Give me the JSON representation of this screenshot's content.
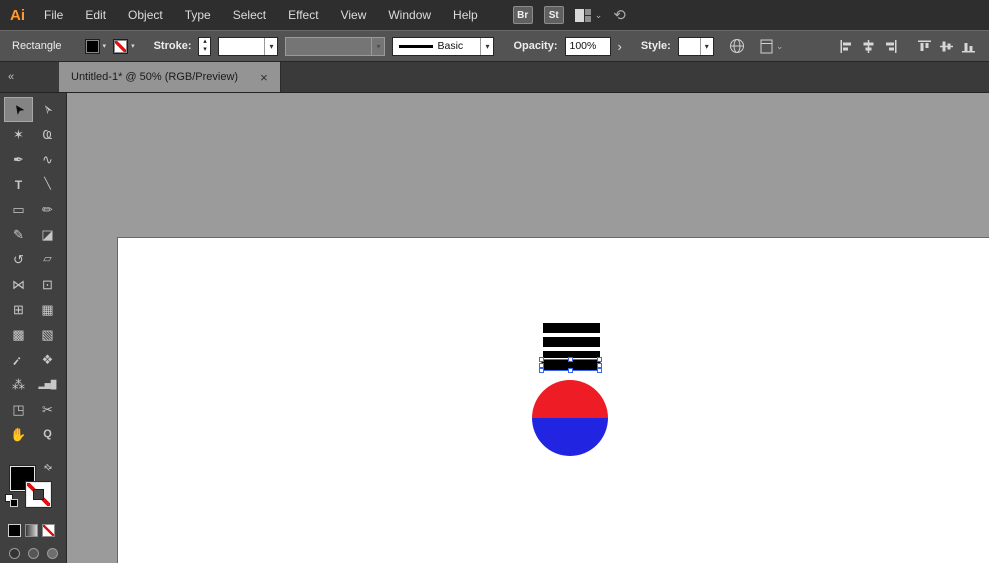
{
  "menubar": {
    "logo": "Ai",
    "items": [
      "File",
      "Edit",
      "Object",
      "Type",
      "Select",
      "Effect",
      "View",
      "Window",
      "Help"
    ],
    "bridge_label": "Br",
    "stock_label": "St"
  },
  "controlbar": {
    "context_label": "Rectangle",
    "stroke_label": "Stroke:",
    "stroke_weight_value": "",
    "brush_value": "",
    "stroke_style_label": "Basic",
    "opacity_label": "Opacity:",
    "opacity_value": "100%",
    "style_label": "Style:"
  },
  "tabbar": {
    "tab_title": "Untitled-1* @ 50% (RGB/Preview)"
  },
  "icons": {
    "caret_up": "▴",
    "caret_down": "▾",
    "flyout_arrow": "›",
    "collapse_panel": "«",
    "close": "×",
    "swap_colors": "⇄",
    "menu_chevron": "⌄",
    "sync_glyph": "⟲"
  },
  "tools": [
    {
      "name": "selection-tool",
      "glyph": "➤",
      "rot": -125,
      "selected": true
    },
    {
      "name": "direct-selection-tool",
      "glyph": "➢",
      "rot": -125
    },
    {
      "name": "magic-wand-tool",
      "glyph": "✶"
    },
    {
      "name": "lasso-tool",
      "glyph": "Ҩ"
    },
    {
      "name": "pen-tool",
      "glyph": "✒"
    },
    {
      "name": "curvature-tool",
      "glyph": "∿"
    },
    {
      "name": "type-tool",
      "glyph": "T",
      "fs": 12,
      "fw": 700
    },
    {
      "name": "line-segment-tool",
      "glyph": "╲",
      "fs": 11
    },
    {
      "name": "rectangle-tool",
      "glyph": "▭"
    },
    {
      "name": "paintbrush-tool",
      "glyph": "✏"
    },
    {
      "name": "pencil-tool",
      "glyph": "✎"
    },
    {
      "name": "eraser-tool",
      "glyph": "◪"
    },
    {
      "name": "rotate-tool",
      "glyph": "↺"
    },
    {
      "name": "scale-tool",
      "glyph": "▱",
      "fs": 11
    },
    {
      "name": "width-tool",
      "glyph": "⋈"
    },
    {
      "name": "free-transform-tool",
      "glyph": "⊡"
    },
    {
      "name": "shape-builder-tool",
      "glyph": "⊞"
    },
    {
      "name": "perspective-grid-tool",
      "glyph": "▦"
    },
    {
      "name": "mesh-tool",
      "glyph": "▩"
    },
    {
      "name": "gradient-tool",
      "glyph": "▧"
    },
    {
      "name": "eyedropper-tool",
      "glyph": "¡",
      "rot": 40,
      "fs": 13,
      "fw": 700
    },
    {
      "name": "blend-tool",
      "glyph": "❖"
    },
    {
      "name": "symbol-sprayer-tool",
      "glyph": "⁂"
    },
    {
      "name": "column-graph-tool",
      "glyph": "▂▅█",
      "fs": 8
    },
    {
      "name": "artboard-tool",
      "glyph": "◳"
    },
    {
      "name": "slice-tool",
      "glyph": "✂"
    },
    {
      "name": "hand-tool",
      "glyph": "✋"
    },
    {
      "name": "zoom-tool",
      "glyph": "Q",
      "fs": 11,
      "fw": 700
    }
  ],
  "artwork": {
    "bars_color": "#000000",
    "circle_top_color": "#ee1d25",
    "circle_bottom_color": "#2125e2",
    "selection_color": "#3a66f0"
  },
  "colors": {
    "logo_orange": "#ff9a2e",
    "canvas_gray": "#9b9b9b"
  }
}
